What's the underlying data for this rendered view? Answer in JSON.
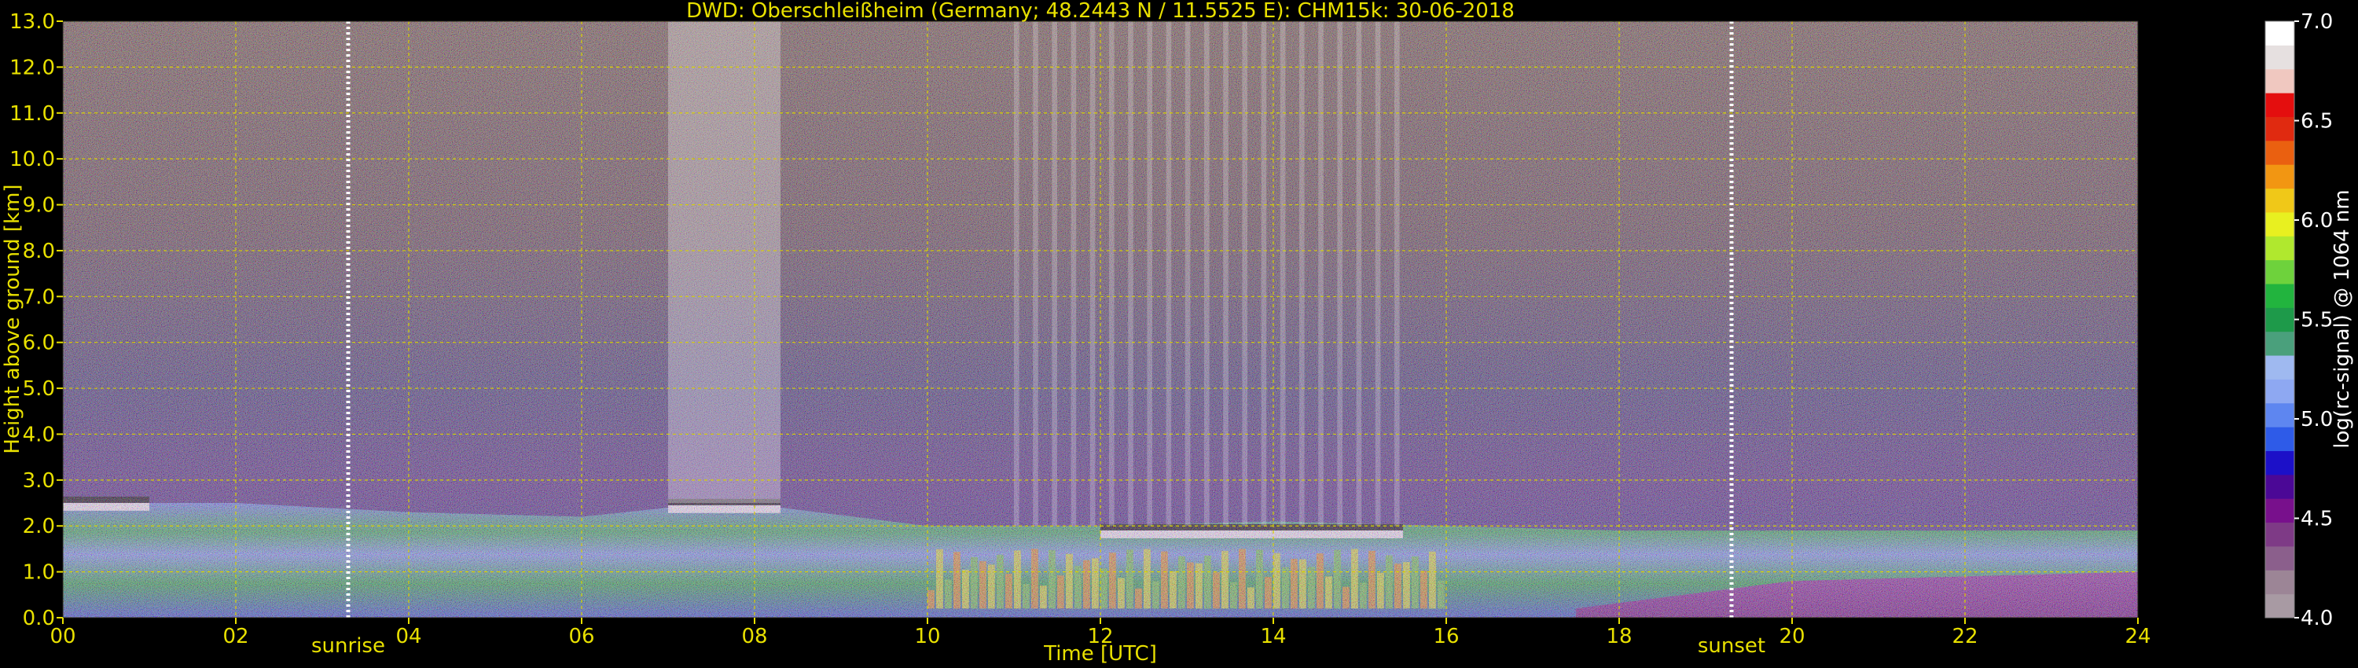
{
  "chart_data": {
    "type": "heatmap",
    "title": "DWD: Oberschleißheim (Germany; 48.2443 N / 11.5525 E):    CHM15k: 30-06-2018",
    "xlabel": "Time [UTC]",
    "ylabel": "Height above ground [km]",
    "xlim": [
      0,
      24
    ],
    "ylim": [
      0,
      13
    ],
    "x_ticks": [
      "00",
      "02",
      "04",
      "06",
      "08",
      "10",
      "12",
      "14",
      "16",
      "18",
      "20",
      "22",
      "24"
    ],
    "y_ticks": [
      "0.0",
      "1.0",
      "2.0",
      "3.0",
      "4.0",
      "5.0",
      "6.0",
      "7.0",
      "8.0",
      "9.0",
      "10.0",
      "11.0",
      "12.0",
      "13.0"
    ],
    "grid": true,
    "colorbar": {
      "label": "log(rc-signal) @ 1064 nm",
      "ticks": [
        "4.0",
        "4.5",
        "5.0",
        "5.5",
        "6.0",
        "6.5",
        "7.0"
      ],
      "range": [
        4.0,
        7.0
      ],
      "colors": [
        "#a89aa3",
        "#9c8596",
        "#8b5f8c",
        "#7e3a86",
        "#78108c",
        "#4b0896",
        "#1c10c8",
        "#2e5be8",
        "#5e86f0",
        "#8ea8f2",
        "#9fb9f0",
        "#4aa07c",
        "#1e9a4a",
        "#22b43e",
        "#6ed23c",
        "#b0e82e",
        "#e8f020",
        "#f0c818",
        "#f29612",
        "#ea6010",
        "#e02a10",
        "#e40e0e",
        "#f0c8c0",
        "#e6e0e0",
        "#ffffff"
      ]
    },
    "markers": [
      {
        "label": "sunrise",
        "x": 3.3
      },
      {
        "label": "sunset",
        "x": 19.3
      }
    ],
    "features": {
      "boundary_layer_top_km": [
        {
          "x": 0.0,
          "y": 2.5
        },
        {
          "x": 2.0,
          "y": 2.5
        },
        {
          "x": 4.0,
          "y": 2.3
        },
        {
          "x": 6.0,
          "y": 2.2
        },
        {
          "x": 7.0,
          "y": 2.4
        },
        {
          "x": 8.3,
          "y": 2.4
        },
        {
          "x": 10.0,
          "y": 2.0
        },
        {
          "x": 12.0,
          "y": 2.0
        },
        {
          "x": 14.0,
          "y": 2.1
        },
        {
          "x": 16.0,
          "y": 2.0
        },
        {
          "x": 18.0,
          "y": 1.9
        },
        {
          "x": 20.0,
          "y": 1.9
        },
        {
          "x": 22.0,
          "y": 1.9
        },
        {
          "x": 24.0,
          "y": 1.9
        }
      ],
      "cloud_layers": [
        {
          "x_start": 0.0,
          "x_end": 1.0,
          "height_km": 2.4
        },
        {
          "x_start": 7.0,
          "x_end": 8.3,
          "height_km": 2.35
        },
        {
          "x_start": 12.0,
          "x_end": 15.5,
          "height_km": 1.8
        }
      ],
      "high_noise_intervals": [
        {
          "x_start": 7.0,
          "x_end": 8.3
        },
        {
          "x_start": 11.0,
          "x_end": 15.5
        }
      ]
    }
  }
}
